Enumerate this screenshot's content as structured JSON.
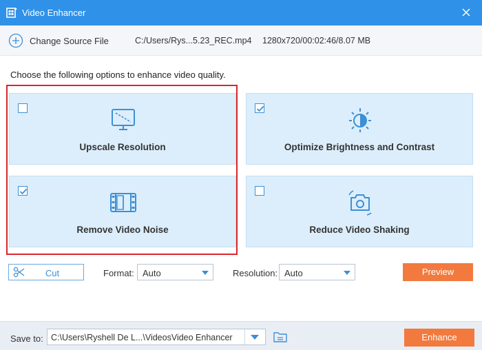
{
  "window": {
    "title": "Video Enhancer",
    "app_icon": "video-enhancer-icon",
    "close_icon": "close-icon"
  },
  "source": {
    "change_label": "Change Source File",
    "file_path": "C:/Users/Rys...5.23_REC.mp4",
    "file_info": "1280x720/00:02:46/8.07 MB"
  },
  "instructions": "Choose the following options to enhance video quality.",
  "options": [
    {
      "label": "Upscale Resolution",
      "checked": false,
      "icon": "monitor-upscale-icon"
    },
    {
      "label": "Optimize Brightness and Contrast",
      "checked": true,
      "icon": "brightness-sun-icon"
    },
    {
      "label": "Remove Video Noise",
      "checked": true,
      "icon": "film-noise-icon"
    },
    {
      "label": "Reduce Video Shaking",
      "checked": false,
      "icon": "camera-stabilize-icon"
    }
  ],
  "controls": {
    "cut_label": "Cut",
    "format_label": "Format:",
    "format_value": "Auto",
    "resolution_label": "Resolution:",
    "resolution_value": "Auto",
    "preview_label": "Preview"
  },
  "footer": {
    "save_label": "Save to:",
    "save_path": "C:\\Users\\Ryshell De L...\\VideosVideo Enhancer",
    "enhance_label": "Enhance"
  },
  "colors": {
    "titlebar": "#2f91e8",
    "accent": "#3d8fd6",
    "action": "#f27a3f",
    "card": "#dceefb",
    "highlight": "#d9262b"
  }
}
